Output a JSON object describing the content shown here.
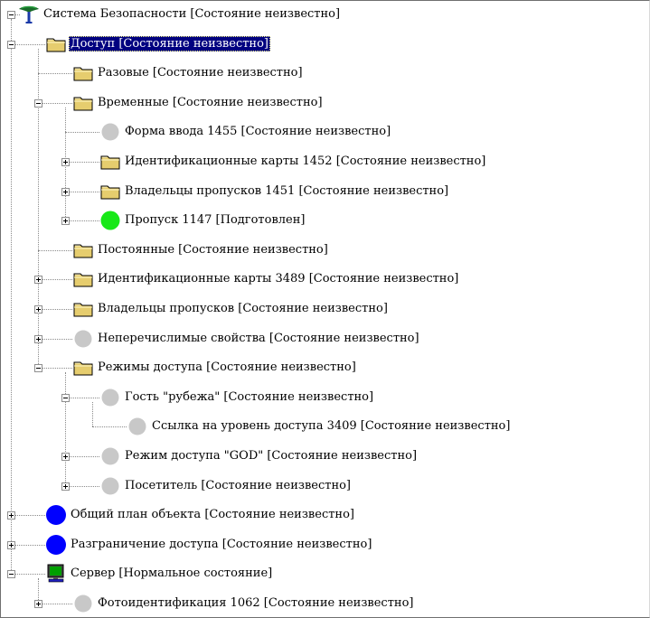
{
  "colors": {
    "selection_bg": "#000080",
    "folder": "#e6cd6e",
    "circle_gray": "#c8c8c8",
    "circle_green": "#18e818",
    "circle_blue": "#0000ff"
  },
  "tree": [
    {
      "depth": 0,
      "expander": "minus",
      "icon": "globe-icon",
      "label": "Система Безопасности [Состояние неизвестно]"
    },
    {
      "depth": 1,
      "expander": "minus",
      "icon": "folder-icon",
      "label": "Доступ [Состояние неизвестно]",
      "selected": true
    },
    {
      "depth": 2,
      "expander": "none",
      "icon": "folder-icon",
      "label": "Разовые [Состояние неизвестно]"
    },
    {
      "depth": 2,
      "expander": "minus",
      "icon": "folder-icon",
      "label": "Временные [Состояние неизвестно]"
    },
    {
      "depth": 3,
      "expander": "none",
      "icon": "circle-gray-icon",
      "label": "Форма ввода 1455 [Состояние неизвестно]"
    },
    {
      "depth": 3,
      "expander": "plus",
      "icon": "folder-icon",
      "label": "Идентификационные карты 1452 [Состояние неизвестно]"
    },
    {
      "depth": 3,
      "expander": "plus",
      "icon": "folder-icon",
      "label": "Владельцы пропусков 1451 [Состояние неизвестно]"
    },
    {
      "depth": 3,
      "expander": "plus",
      "icon": "circle-green-icon",
      "label": "Пропуск 1147 [Подготовлен]"
    },
    {
      "depth": 2,
      "expander": "none",
      "icon": "folder-icon",
      "label": "Постоянные [Состояние неизвестно]"
    },
    {
      "depth": 2,
      "expander": "plus",
      "icon": "folder-icon",
      "label": "Идентификационные карты 3489 [Состояние неизвестно]"
    },
    {
      "depth": 2,
      "expander": "plus",
      "icon": "folder-icon",
      "label": "Владельцы пропусков [Состояние неизвестно]"
    },
    {
      "depth": 2,
      "expander": "plus",
      "icon": "circle-gray-icon",
      "label": "Неперечислимые свойства [Состояние неизвестно]"
    },
    {
      "depth": 2,
      "expander": "minus",
      "icon": "folder-icon",
      "label": "Режимы доступа [Состояние неизвестно]"
    },
    {
      "depth": 3,
      "expander": "minus",
      "icon": "circle-gray-icon",
      "label": "Гость \"рубежа\" [Состояние неизвестно]"
    },
    {
      "depth": 4,
      "expander": "none",
      "icon": "circle-gray-icon",
      "label": "Ссылка на уровень доступа 3409 [Состояние неизвестно]"
    },
    {
      "depth": 3,
      "expander": "plus",
      "icon": "circle-gray-icon",
      "label": "Режим доступа \"GOD\" [Состояние неизвестно]"
    },
    {
      "depth": 3,
      "expander": "plus",
      "icon": "circle-gray-icon",
      "label": "Посетитель [Состояние неизвестно]"
    },
    {
      "depth": 1,
      "expander": "plus",
      "icon": "circle-blue-icon",
      "label": "Общий план объекта [Состояние неизвестно]"
    },
    {
      "depth": 1,
      "expander": "plus",
      "icon": "circle-blue-icon",
      "label": "Разграничение доступа [Состояние неизвестно]"
    },
    {
      "depth": 1,
      "expander": "minus",
      "icon": "monitor-icon",
      "label": "Сервер [Нормальное состояние]"
    },
    {
      "depth": 2,
      "expander": "plus",
      "icon": "circle-gray-icon",
      "label": "Фотоидентификация 1062 [Состояние неизвестно]"
    }
  ]
}
